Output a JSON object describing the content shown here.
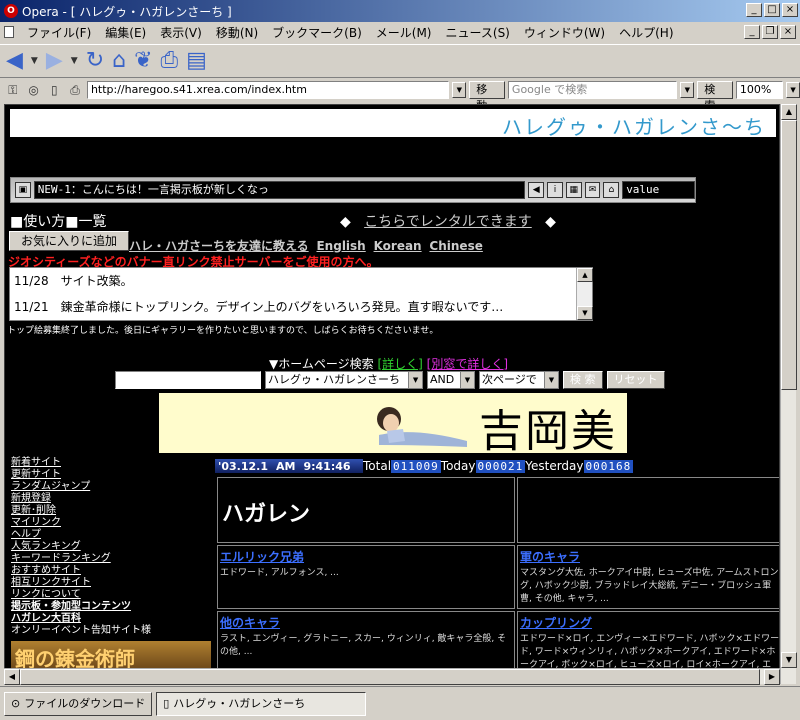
{
  "window": {
    "title": "Opera - [ ハレグゥ・ハガレンさーち ]",
    "icon": "opera-icon"
  },
  "menu": [
    "ファイル(F)",
    "編集(E)",
    "表示(V)",
    "移動(N)",
    "ブックマーク(B)",
    "メール(M)",
    "ニュース(S)",
    "ウィンドウ(W)",
    "ヘルプ(H)"
  ],
  "address": {
    "url": "http://haregoo.s41.xrea.com/index.htm",
    "go_label": "移動",
    "search_placeholder": "Google で検索",
    "search_label": "検索",
    "zoom": "100%"
  },
  "page": {
    "banner_title": "ハレグゥ・ハガレンさ〜ち",
    "ticker_text": "NEW-1：こんにちは！一言掲示板が新しくなっ",
    "ticker_value": "value",
    "guide_text": "■使い方■一覧",
    "rental_text": "こちらでレンタルできます",
    "fav_button": "お気に入りに追加",
    "share_text": "ハレ・ハガさーちを友達に教える",
    "lang_links": [
      "English",
      "Korean",
      "Chinese"
    ],
    "warning": "ジオシティーズなどのバナー直リンク禁止サーバーをご使用の方へ。",
    "news": [
      "11/28　サイト改築。",
      "11/21　錬金革命様にトップリンク。デザイン上のバグをいろいろ発見。直す暇ないです…"
    ],
    "notice": "トップ絵募集終了しました。後日にギャラリーを作りたいと思いますので、しばらくお待ちくださいませ。",
    "search_head": "▼ホームページ検索",
    "search_detail": "[詳しく]",
    "search_detail2": "[別窓で詳しく]",
    "search_site": "ハレグゥ・ハガレンさーちで",
    "search_mode": "AND",
    "search_next": "次ページで",
    "search_btn": "検 索",
    "reset_btn": "リセット",
    "ad_name": "吉岡美",
    "left_nav": [
      "新着サイト",
      "更新サイト",
      "ランダムジャンプ",
      "新規登録",
      "更新･削除",
      "マイリンク",
      "ヘルプ",
      "人気ランキング",
      "キーワードランキング",
      "おすすめサイト",
      "相互リンクサイト",
      "リンクについて"
    ],
    "left_nav_bold": [
      "掲示板・参加型コンテンツ",
      "ハガレン大百科"
    ],
    "left_nav_plain": "オンリーイベント告知サイト様",
    "left_banner": "鋼の錬金術師",
    "counter": {
      "date": "'03.12.1",
      "am": "AM",
      "time": "9:41:46",
      "total_label": "Total",
      "total": "011009",
      "today_label": "Today",
      "today": "000021",
      "yesterday_label": "Yesterday",
      "yesterday": "000168"
    },
    "category_title": "ハガレン",
    "cells": [
      {
        "title": "エルリック兄弟",
        "text": "エドワード, アルフォンス, ..."
      },
      {
        "title": "軍のキャラ",
        "text": "マスタング大佐, ホークアイ中尉, ヒューズ中佐, アームストロング, ハボック少尉, ブラッドレイ大総統, デニー・ブロッシュ軍曹, その他, キャラ, ..."
      },
      {
        "title": "他のキャラ",
        "text": "ラスト, エンヴィー, グラトニー, スカー, ウィンリィ, 敵キャラ全般, その他, ..."
      },
      {
        "title": "カップリング",
        "text": "エドワード×ロイ, エンヴィー×エドワード, ハボック×エドワード, ワード×ウィンリィ, ハボック×ホークアイ, エドワード×ホークアイ, ボック×ロイ, ヒューズ×ロイ, ロイ×ホークアイ, エドワード×ロイ"
      }
    ]
  },
  "status": {
    "tab1": "ファイルのダウンロード",
    "tab2": "ハレグゥ・ハガレンさーち"
  }
}
